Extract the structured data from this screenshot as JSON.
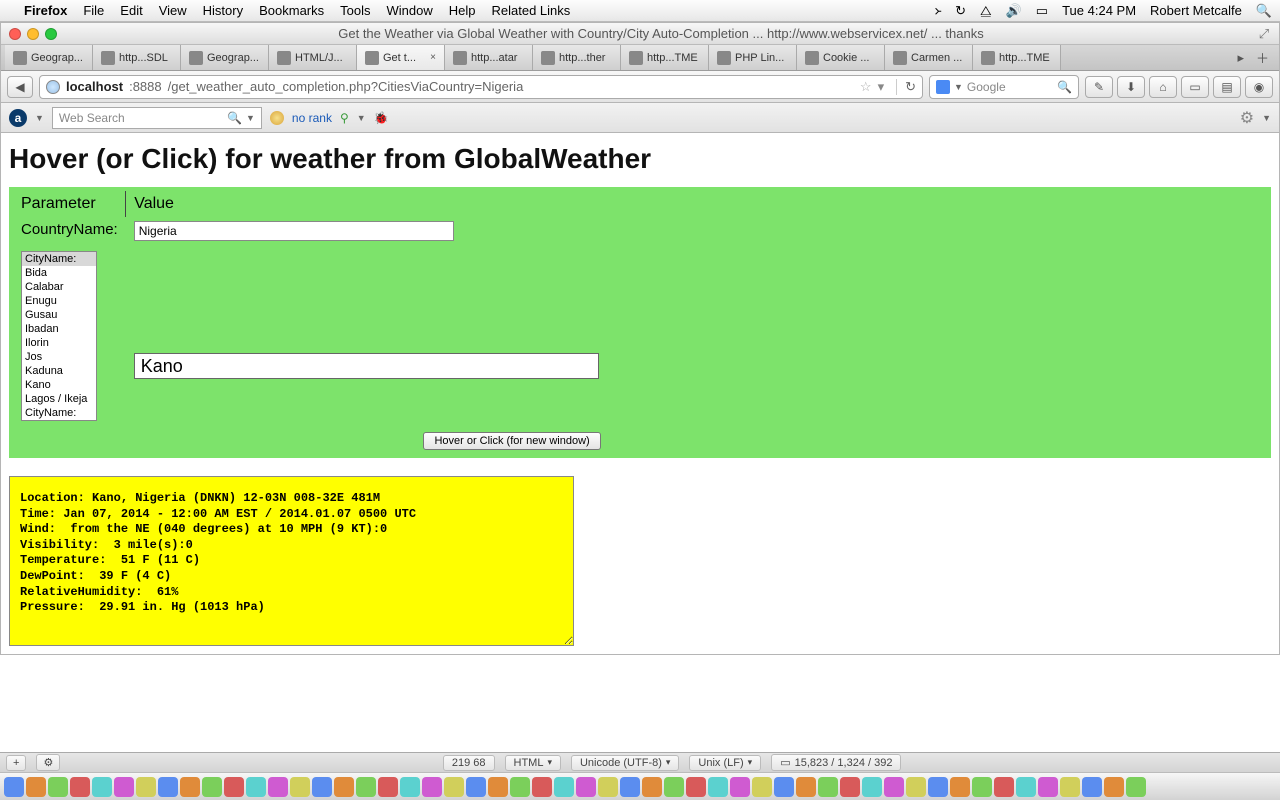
{
  "menubar": {
    "app": "Firefox",
    "items": [
      "File",
      "Edit",
      "View",
      "History",
      "Bookmarks",
      "Tools",
      "Window",
      "Help",
      "Related Links"
    ],
    "clock": "Tue 4:24 PM",
    "user": "Robert Metcalfe"
  },
  "window": {
    "title": "Get the Weather via Global Weather with Country/City Auto-Completion ... http://www.webservicex.net/ ... thanks"
  },
  "tabs": [
    {
      "label": "Geograp..."
    },
    {
      "label": "http...SDL"
    },
    {
      "label": "Geograp..."
    },
    {
      "label": "HTML/J..."
    },
    {
      "label": "Get t...",
      "active": true
    },
    {
      "label": "http...atar"
    },
    {
      "label": "http...ther"
    },
    {
      "label": "http...TME"
    },
    {
      "label": "PHP Lin..."
    },
    {
      "label": "Cookie ..."
    },
    {
      "label": "Carmen ..."
    },
    {
      "label": "http...TME"
    }
  ],
  "url": {
    "host": "localhost",
    "port": ":8888",
    "path": "/get_weather_auto_completion.php?CitiesViaCountry=Nigeria"
  },
  "searchbox": {
    "placeholder": "Google"
  },
  "toolbar2": {
    "web_placeholder": "Web Search",
    "norank": "no rank"
  },
  "page": {
    "heading": "Hover (or Click) for weather from GlobalWeather",
    "header_param": "Parameter",
    "header_value": "Value",
    "country_label": "CountryName:",
    "country_value": "Nigeria",
    "city_listbox": [
      "CityName:",
      "Bida",
      "Calabar",
      "Enugu",
      "Gusau",
      "Ibadan",
      "Ilorin",
      "Jos",
      "Kaduna",
      "Kano",
      "Lagos / Ikeja",
      "CityName:"
    ],
    "city_value": "Kano",
    "button": "Hover or Click (for new window)",
    "result": "Location: Kano, Nigeria (DNKN) 12-03N 008-32E 481M\nTime: Jan 07, 2014 - 12:00 AM EST / 2014.01.07 0500 UTC\nWind:  from the NE (040 degrees) at 10 MPH (9 KT):0\nVisibility:  3 mile(s):0\nTemperature:  51 F (11 C)\nDewPoint:  39 F (4 C)\nRelativeHumidity:  61%\nPressure:  29.91 in. Hg (1013 hPa)"
  },
  "statusbar": {
    "left_nums": "219  68",
    "mode": "HTML",
    "encoding": "Unicode (UTF-8)",
    "lineend": "Unix (LF)",
    "pos": "15,823 / 1,324 / 392"
  },
  "dock_colors": [
    "#5b8def",
    "#e08b3a",
    "#7bcf5b",
    "#d85a5a",
    "#5bd1cf",
    "#cf5bd1",
    "#d1cf5b",
    "#5b8def",
    "#e08b3a",
    "#7bcf5b",
    "#d85a5a",
    "#5bd1cf",
    "#cf5bd1",
    "#d1cf5b",
    "#5b8def",
    "#e08b3a",
    "#7bcf5b",
    "#d85a5a",
    "#5bd1cf",
    "#cf5bd1",
    "#d1cf5b",
    "#5b8def",
    "#e08b3a",
    "#7bcf5b",
    "#d85a5a",
    "#5bd1cf",
    "#cf5bd1",
    "#d1cf5b",
    "#5b8def",
    "#e08b3a",
    "#7bcf5b",
    "#d85a5a",
    "#5bd1cf",
    "#cf5bd1",
    "#d1cf5b",
    "#5b8def",
    "#e08b3a",
    "#7bcf5b",
    "#d85a5a",
    "#5bd1cf",
    "#cf5bd1",
    "#d1cf5b",
    "#5b8def",
    "#e08b3a",
    "#7bcf5b",
    "#d85a5a",
    "#5bd1cf",
    "#cf5bd1",
    "#d1cf5b",
    "#5b8def",
    "#e08b3a",
    "#7bcf5b"
  ]
}
